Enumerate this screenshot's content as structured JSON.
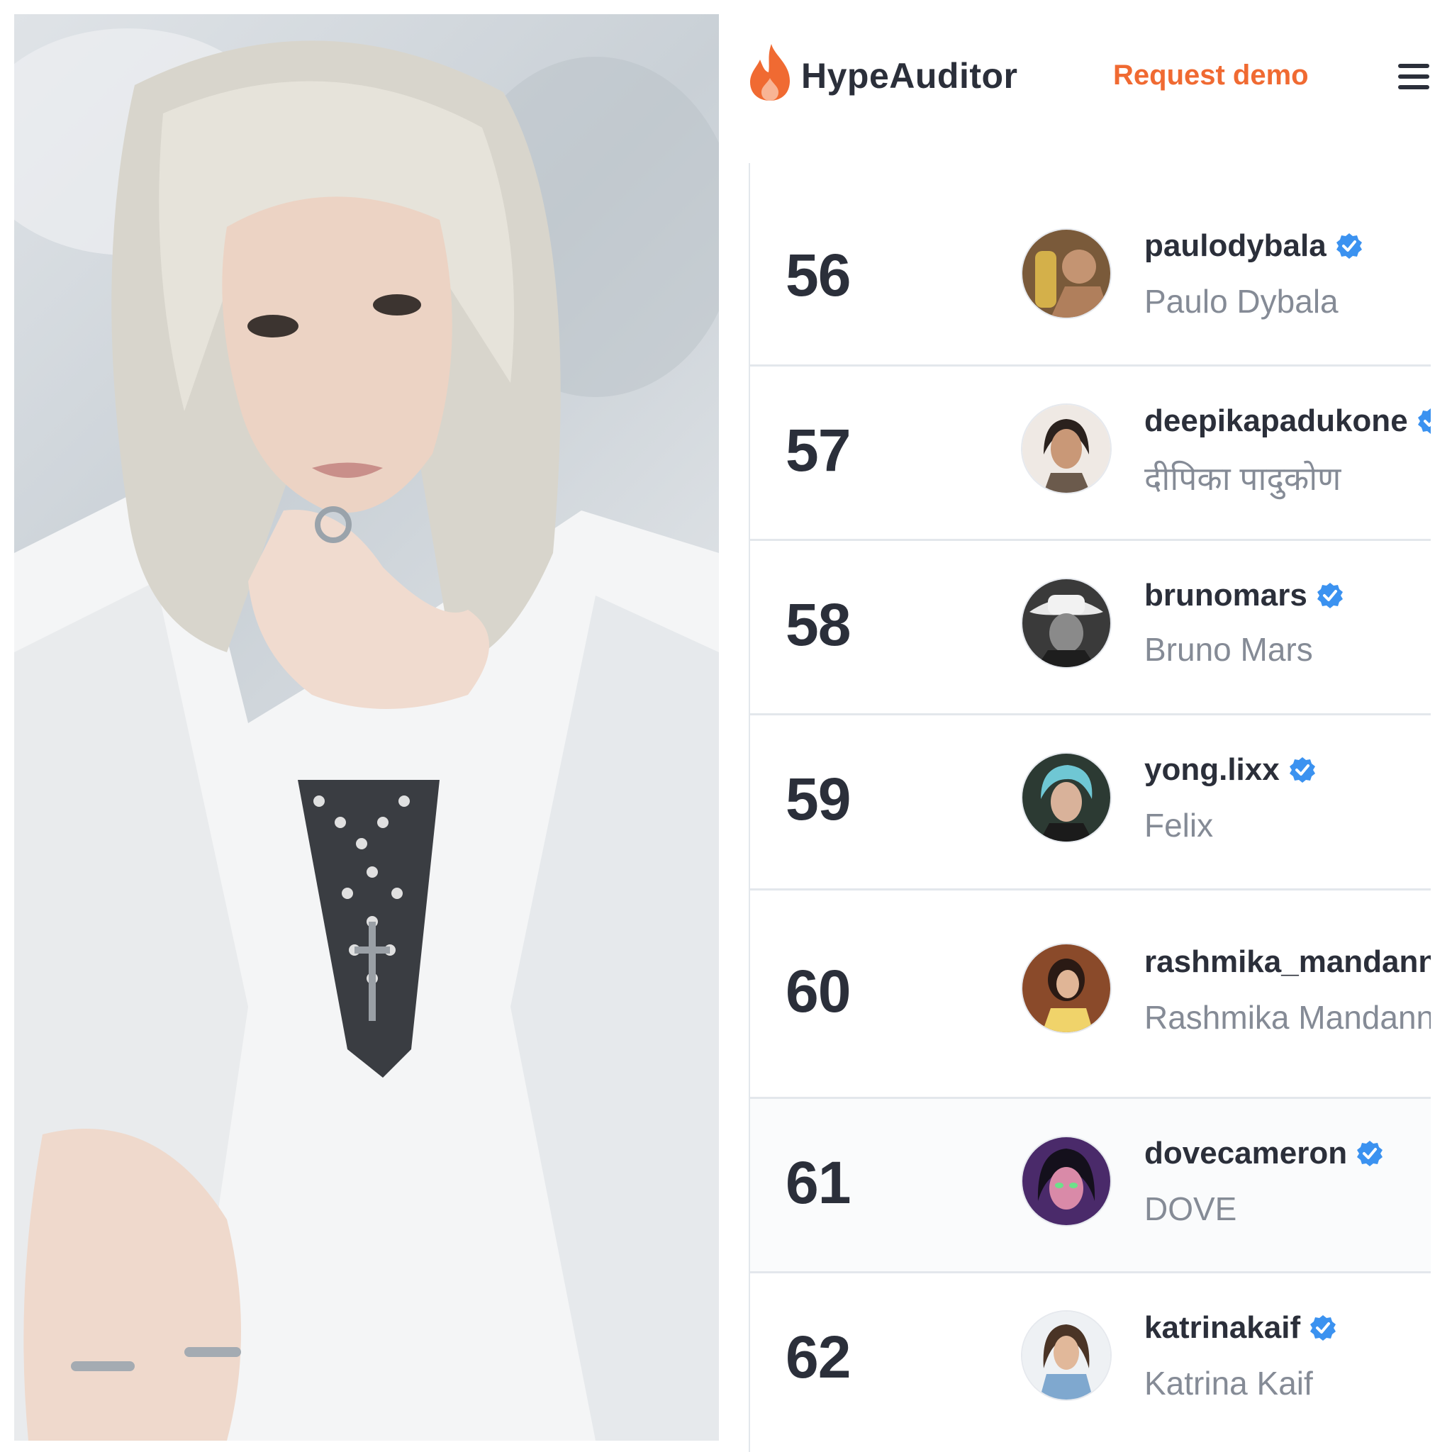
{
  "header": {
    "brand": "HypeAuditor",
    "request_demo": "Request demo"
  },
  "colors": {
    "accent": "#f06a32",
    "verified": "#3b92f0",
    "rank_text": "#2b2f3a",
    "name_text": "#858b96"
  },
  "rows": [
    {
      "rank": "56",
      "handle": "paulodybala",
      "name": "Paulo Dybala",
      "verified": true
    },
    {
      "rank": "57",
      "handle": "deepikapadukone",
      "name": "दीपिका पादुकोण",
      "verified": true
    },
    {
      "rank": "58",
      "handle": "brunomars",
      "name": "Bruno Mars",
      "verified": true
    },
    {
      "rank": "59",
      "handle": "yong.lixx",
      "name": "Felix",
      "verified": true
    },
    {
      "rank": "60",
      "handle": "rashmika_mandanna",
      "name": "Rashmika Mandanna",
      "verified": true
    },
    {
      "rank": "61",
      "handle": "dovecameron",
      "name": "DOVE",
      "verified": true
    },
    {
      "rank": "62",
      "handle": "katrinakaif",
      "name": "Katrina Kaif",
      "verified": true
    }
  ]
}
